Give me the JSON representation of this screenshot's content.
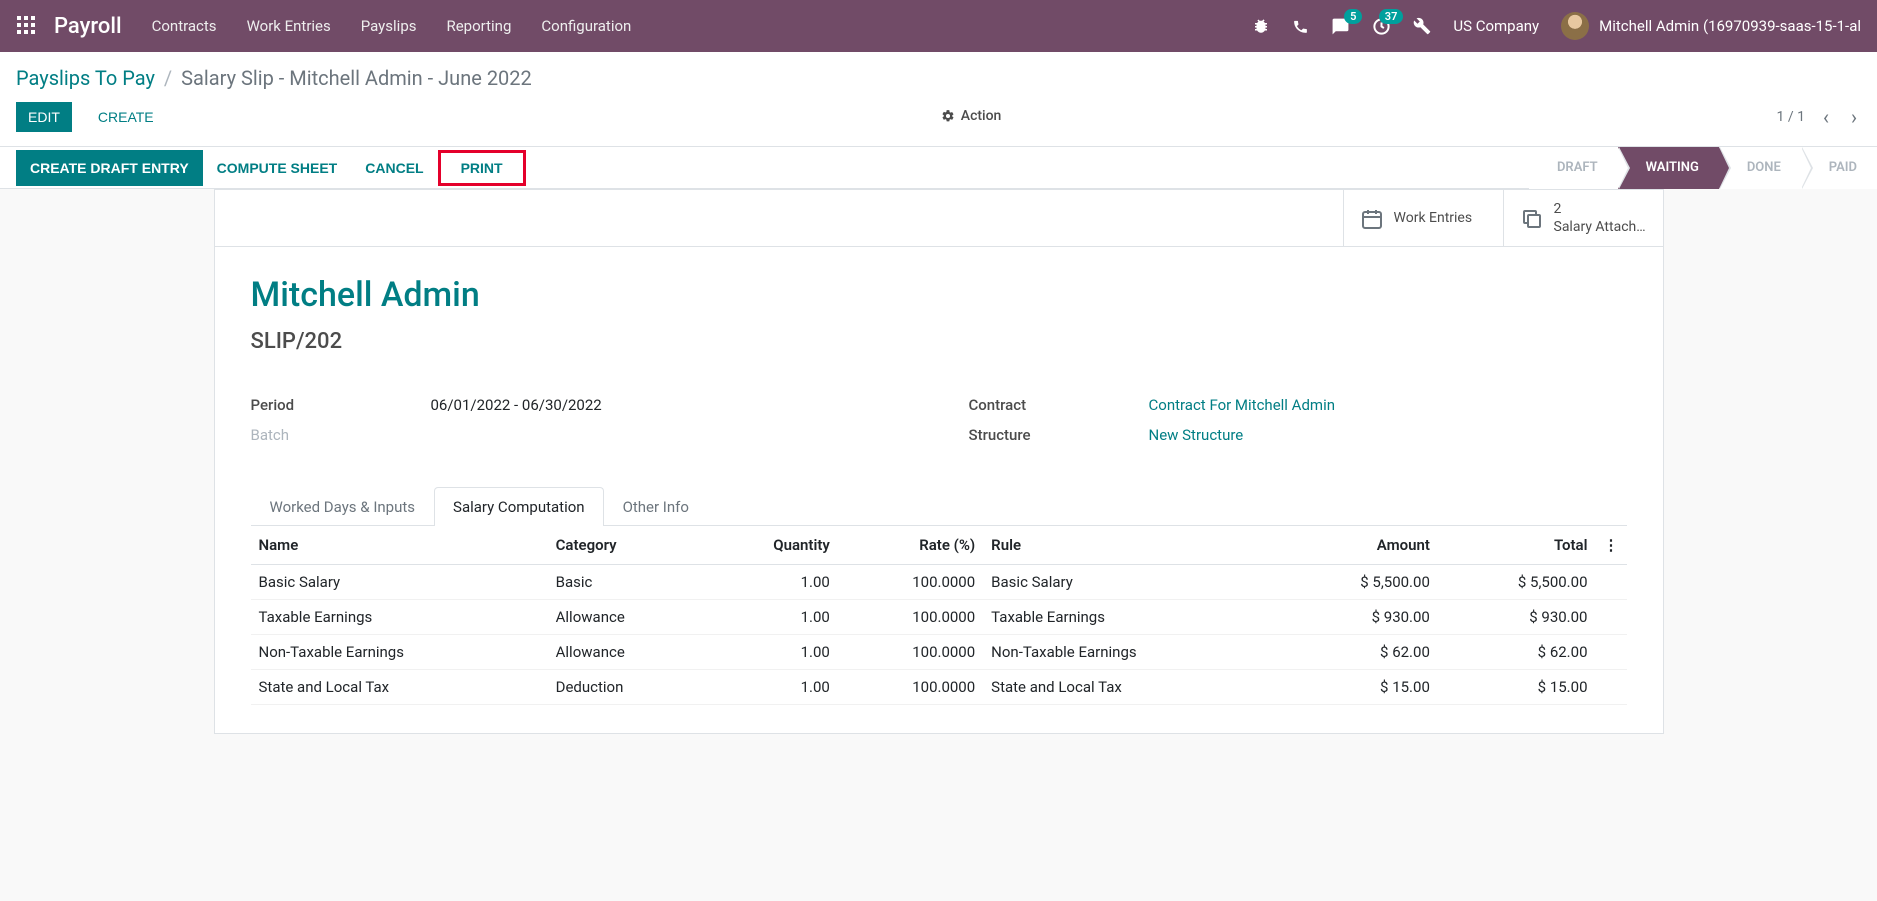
{
  "navbar": {
    "brand": "Payroll",
    "links": [
      "Contracts",
      "Work Entries",
      "Payslips",
      "Reporting",
      "Configuration"
    ],
    "msg_count": "5",
    "activity_count": "37",
    "company": "US Company",
    "user": "Mitchell Admin (16970939-saas-15-1-al"
  },
  "breadcrumb": {
    "parent": "Payslips To Pay",
    "current": "Salary Slip - Mitchell Admin - June 2022"
  },
  "cp": {
    "edit": "EDIT",
    "create": "CREATE",
    "action": "Action",
    "pager": "1 / 1"
  },
  "statusbar": {
    "buttons": [
      "CREATE DRAFT ENTRY",
      "COMPUTE SHEET",
      "CANCEL",
      "PRINT"
    ],
    "states": [
      "DRAFT",
      "WAITING",
      "DONE",
      "PAID"
    ],
    "active_state": "WAITING"
  },
  "stat_buttons": {
    "work_entries": "Work Entries",
    "attach_count": "2",
    "attach_label": "Salary Attach…"
  },
  "record": {
    "title": "Mitchell Admin",
    "ref": "SLIP/202",
    "period_label": "Period",
    "period_value": "06/01/2022 - 06/30/2022",
    "batch_label": "Batch",
    "batch_value": "",
    "contract_label": "Contract",
    "contract_value": "Contract For Mitchell Admin",
    "structure_label": "Structure",
    "structure_value": "New Structure"
  },
  "tabs": [
    "Worked Days & Inputs",
    "Salary Computation",
    "Other Info"
  ],
  "active_tab": "Salary Computation",
  "table": {
    "headers": [
      "Name",
      "Category",
      "Quantity",
      "Rate (%)",
      "Rule",
      "Amount",
      "Total"
    ],
    "rows": [
      {
        "name": "Basic Salary",
        "category": "Basic",
        "qty": "1.00",
        "rate": "100.0000",
        "rule": "Basic Salary",
        "amount": "$ 5,500.00",
        "total": "$ 5,500.00"
      },
      {
        "name": "Taxable Earnings",
        "category": "Allowance",
        "qty": "1.00",
        "rate": "100.0000",
        "rule": "Taxable Earnings",
        "amount": "$ 930.00",
        "total": "$ 930.00"
      },
      {
        "name": "Non-Taxable Earnings",
        "category": "Allowance",
        "qty": "1.00",
        "rate": "100.0000",
        "rule": "Non-Taxable Earnings",
        "amount": "$ 62.00",
        "total": "$ 62.00"
      },
      {
        "name": "State and Local Tax",
        "category": "Deduction",
        "qty": "1.00",
        "rate": "100.0000",
        "rule": "State and Local Tax",
        "amount": "$ 15.00",
        "total": "$ 15.00"
      }
    ]
  }
}
